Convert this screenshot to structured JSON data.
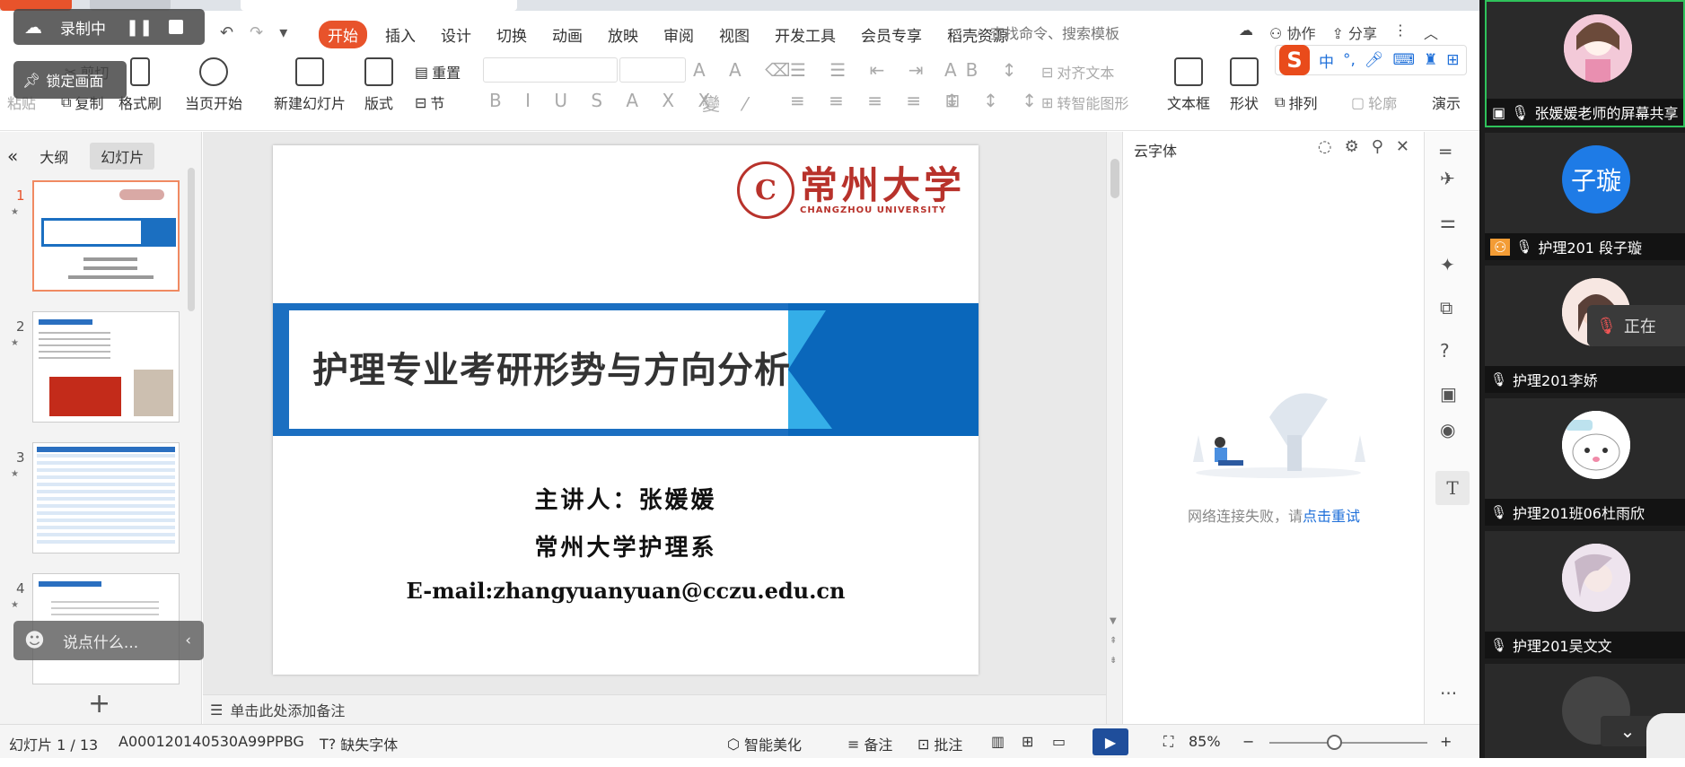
{
  "recorder": {
    "label": "录制中",
    "lock_label": "锁定画面"
  },
  "quick_access": {
    "undo": "↶",
    "redo": "↷",
    "more": "▾"
  },
  "menu": {
    "items": [
      "开始",
      "插入",
      "设计",
      "切换",
      "动画",
      "放映",
      "审阅",
      "视图",
      "开发工具",
      "会员专享",
      "稻壳资源"
    ],
    "search_placeholder": "查找命令、搜索模板",
    "collab": "协作",
    "share": "分享"
  },
  "ribbon": {
    "cut": "剪切",
    "paste": "粘贴",
    "copy": "复制",
    "format_painter": "格式刷",
    "start_from_current": "当页开始",
    "new_slide": "新建幻灯片",
    "layout": "版式",
    "reset": "重置",
    "section": "节",
    "align_text": "对齐文本",
    "convert_smartart": "转智能图形",
    "textbox": "文本框",
    "shape": "形状",
    "arrange": "排列",
    "outline": "轮廓",
    "presentation": "演示"
  },
  "ime": {
    "chinese": "中",
    "punct": "°,"
  },
  "left_panel": {
    "tab_outline": "大纲",
    "tab_slides": "幻灯片",
    "slide_numbers": [
      "1",
      "2",
      "3",
      "4"
    ],
    "add": "+"
  },
  "slide": {
    "logo_cn": "常州大学",
    "logo_en": "CHANGZHOU UNIVERSITY",
    "title": "护理专业考研形势与方向分析",
    "presenter": "主讲人：张媛媛",
    "department": "常州大学护理系",
    "email": "E-mail:zhangyuanyuan@cczu.edu.cn"
  },
  "notes_placeholder": "单击此处添加备注",
  "right_panel": {
    "title": "云字体",
    "error_text": "网络连接失败，请",
    "retry_link": "点击重试"
  },
  "chat": {
    "placeholder": "说点什么..."
  },
  "status": {
    "slide_count": "幻灯片 1 / 13",
    "doc_id": "A000120140530A99PPBG",
    "missing_font": "缺失字体",
    "beautify": "智能美化",
    "notes": "备注",
    "comment": "批注",
    "zoom": "85%"
  },
  "video_sidebar": {
    "participants": [
      {
        "name": "张媛媛老师的屏幕共享"
      },
      {
        "name": "护理201 段子璇",
        "initials": "子璇"
      },
      {
        "name": "护理201李娇"
      },
      {
        "name": "护理201班06杜雨欣"
      },
      {
        "name": "护理201吴文文"
      }
    ],
    "speaking_label": "正在"
  },
  "colors": {
    "accent": "#e8532b",
    "slide_blue": "#1b6fc1",
    "slide_light_blue": "#34aee8",
    "logo_red": "#b8322b",
    "link_blue": "#1e6fd9"
  }
}
